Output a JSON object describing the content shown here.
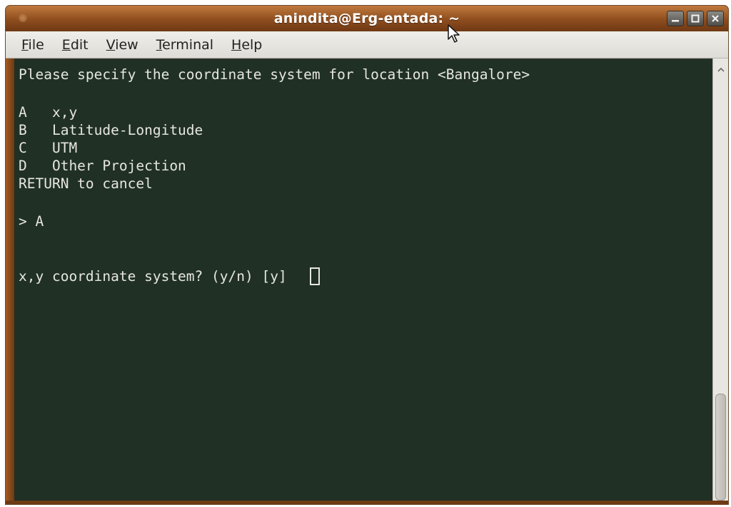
{
  "window": {
    "title": "anindita@Erg-entada: ~",
    "controls": [
      "minimize",
      "maximize",
      "close"
    ]
  },
  "menu": {
    "file": {
      "ul": "F",
      "rest": "ile"
    },
    "edit": {
      "ul": "E",
      "rest": "dit"
    },
    "view": {
      "ul": "V",
      "rest": "iew"
    },
    "terminal": {
      "ul": "T",
      "rest": "erminal"
    },
    "help": {
      "ul": "H",
      "rest": "elp"
    }
  },
  "terminal": {
    "lines": [
      "Please specify the coordinate system for location <Bangalore>",
      "A   x,y",
      "B   Latitude-Longitude",
      "C   UTM",
      "D   Other Projection",
      "RETURN to cancel",
      "> A",
      "x,y coordinate system? (y/n) [y] "
    ]
  },
  "scrollbar": {
    "position_fraction": 1.0
  },
  "colors": {
    "terminal_bg": "#203025",
    "terminal_fg": "#e6e6e0",
    "titlebar": "#8e4d1e"
  },
  "icons": {
    "app": "window-menu-icon",
    "minimize": "minimize-icon",
    "maximize": "maximize-icon",
    "close": "close-icon",
    "scroll_up": "chevron-up-icon",
    "pointer": "mouse-pointer-icon"
  }
}
